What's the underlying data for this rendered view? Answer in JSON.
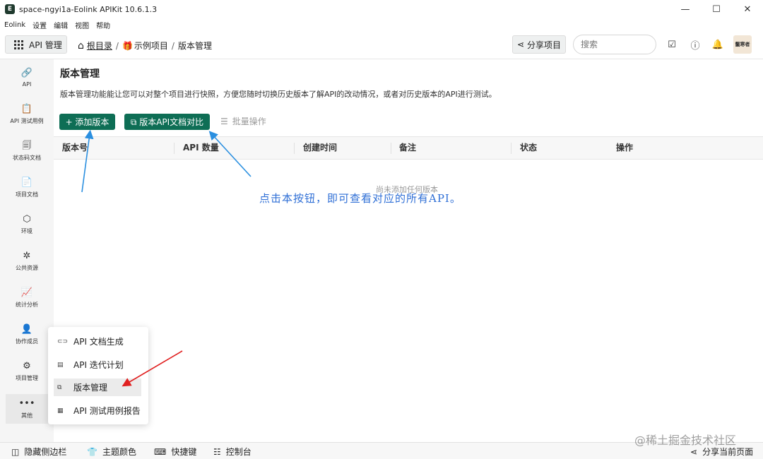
{
  "window": {
    "logo": "E",
    "title": "space-ngyi1a-Eolink APIKit 10.6.1.3",
    "minimize": "—",
    "maximize": "☐",
    "close": "✕"
  },
  "menu": [
    "Eolink",
    "设置",
    "编辑",
    "视图",
    "帮助"
  ],
  "header": {
    "api_mgmt_label": "API 管理",
    "breadcrumb": {
      "root": "根目录",
      "sep1": "/",
      "project": "示例项目",
      "sep2": "/",
      "current": "版本管理"
    },
    "share_label": "分享项目",
    "search_placeholder": "搜索",
    "avatar_text": "鬣寒者"
  },
  "sidebar": {
    "items": [
      {
        "label": "API",
        "icon": "🔗"
      },
      {
        "label": "API 测试用例",
        "icon": "📋"
      },
      {
        "label": "状态码文档",
        "icon": "🗐"
      },
      {
        "label": "项目文档",
        "icon": "📄"
      },
      {
        "label": "环境",
        "icon": "⬡"
      },
      {
        "label": "公共资源",
        "icon": "✲"
      },
      {
        "label": "统计分析",
        "icon": "📈"
      },
      {
        "label": "协作成员",
        "icon": "👤"
      },
      {
        "label": "项目管理",
        "icon": "⚙"
      },
      {
        "label": "其他",
        "icon": "•••"
      }
    ]
  },
  "main": {
    "title": "版本管理",
    "description": "版本管理功能能让您可以对整个项目进行快照，方便您随时切换历史版本了解API的改动情况，或者对历史版本的API进行测试。",
    "add_version": "+ 添加版本",
    "compare_docs": "⧉ 版本API文档对比",
    "batch_ops": "批量操作",
    "columns": [
      "版本号",
      "API 数量",
      "创建时间",
      "备注",
      "状态",
      "操作"
    ],
    "empty": "尚未添加任何版本",
    "annotation": "点击本按钮，即可查看对应的所有API。"
  },
  "popup": {
    "items": [
      {
        "label": "API 文档生成",
        "icon": "⊂⊃"
      },
      {
        "label": "API 迭代计划",
        "icon": "▤"
      },
      {
        "label": "版本管理",
        "icon": "⧉"
      },
      {
        "label": "API 测试用例报告",
        "icon": "▦"
      }
    ]
  },
  "statusbar": {
    "hide_sidebar": "隐藏侧边栏",
    "theme_color": "主题颜色",
    "shortcuts": "快捷键",
    "console": "控制台",
    "share_page": "分享当前页面"
  },
  "watermark": "@稀土掘金技术社区",
  "colors": {
    "primary": "#0e6e55",
    "annotation": "#2f6fd6",
    "arrow_red": "#e02020",
    "arrow_blue": "#2a8fe0"
  }
}
